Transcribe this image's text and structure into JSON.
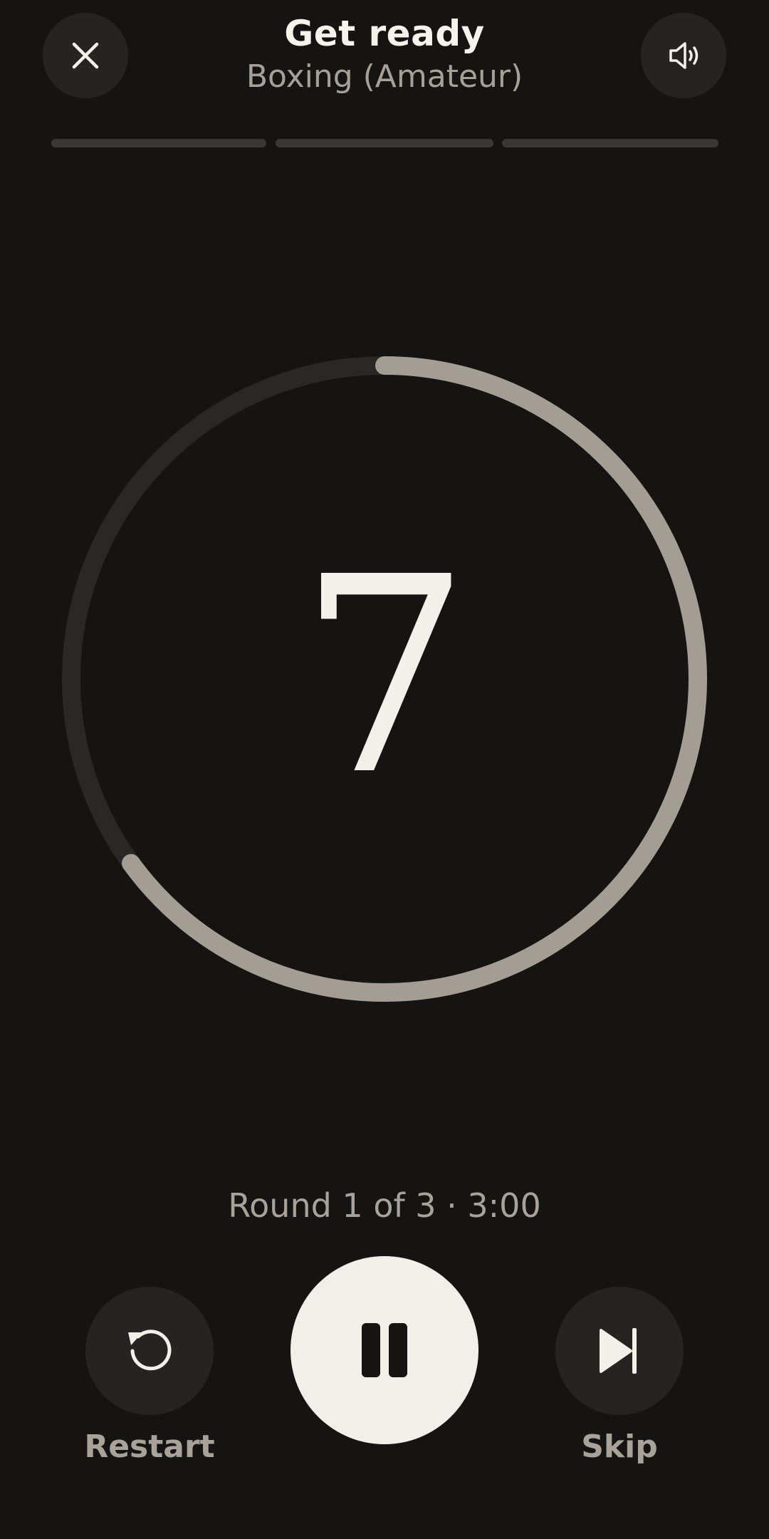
{
  "header": {
    "title": "Get ready",
    "subtitle": "Boxing (Amateur)"
  },
  "countdown": {
    "value": "7",
    "ring_progress_fraction": 0.65
  },
  "progress_segments": [
    {
      "state": "pending"
    },
    {
      "state": "pending"
    },
    {
      "state": "pending"
    }
  ],
  "round_info": "Round 1 of 3 · 3:00",
  "controls": {
    "restart_label": "Restart",
    "skip_label": "Skip"
  },
  "icons": {
    "close": "close-icon",
    "sound": "speaker-icon",
    "restart": "restart-icon",
    "pause": "pause-icon",
    "skip": "skip-next-icon"
  },
  "colors": {
    "background": "#151413",
    "surface": "#262422",
    "ring_track": "#2a2826",
    "ring_progress": "#a39d94",
    "primary_text": "#f3efe9",
    "secondary_text": "#a8a299"
  }
}
